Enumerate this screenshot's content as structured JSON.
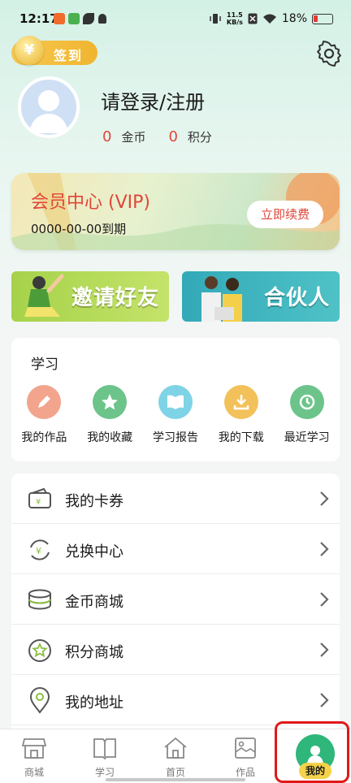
{
  "status_bar": {
    "time": "12:17",
    "speed_value": "11.5",
    "speed_unit": "KB/s",
    "battery": "18%"
  },
  "header": {
    "signin_label": "签到",
    "coin_symbol": "¥"
  },
  "profile": {
    "login_text": "请登录/注册",
    "coins_value": "0",
    "coins_label": "金币",
    "points_value": "0",
    "points_label": "积分"
  },
  "vip": {
    "title": "会员中心 (VIP)",
    "expire": "0000-00-00到期",
    "renew_button": "立即续费"
  },
  "banners": {
    "invite": "邀请好友",
    "partner": "合伙人"
  },
  "study": {
    "title": "学习",
    "items": [
      {
        "label": "我的作品",
        "icon": "pencil-icon",
        "color": "#f2a58c"
      },
      {
        "label": "我的收藏",
        "icon": "star-icon",
        "color": "#6cc48a"
      },
      {
        "label": "学习报告",
        "icon": "book-icon",
        "color": "#7fd3e6"
      },
      {
        "label": "我的下载",
        "icon": "download-icon",
        "color": "#f3c15a"
      },
      {
        "label": "最近学习",
        "icon": "history-icon",
        "color": "#6cc48a"
      }
    ]
  },
  "menu": {
    "items": [
      {
        "label": "我的卡券",
        "icon": "wallet-icon"
      },
      {
        "label": "兑换中心",
        "icon": "exchange-icon"
      },
      {
        "label": "金币商城",
        "icon": "coins-stack-icon"
      },
      {
        "label": "积分商城",
        "icon": "star-badge-icon"
      },
      {
        "label": "我的地址",
        "icon": "location-pin-icon"
      }
    ]
  },
  "bottom_nav": {
    "items": [
      {
        "label": "商城",
        "icon": "shop-icon"
      },
      {
        "label": "学习",
        "icon": "open-book-icon"
      },
      {
        "label": "首页",
        "icon": "home-icon"
      },
      {
        "label": "作品",
        "icon": "picture-icon"
      }
    ],
    "active_label": "我的",
    "active_icon": "profile-icon",
    "accent_color": "#2fb67a"
  }
}
